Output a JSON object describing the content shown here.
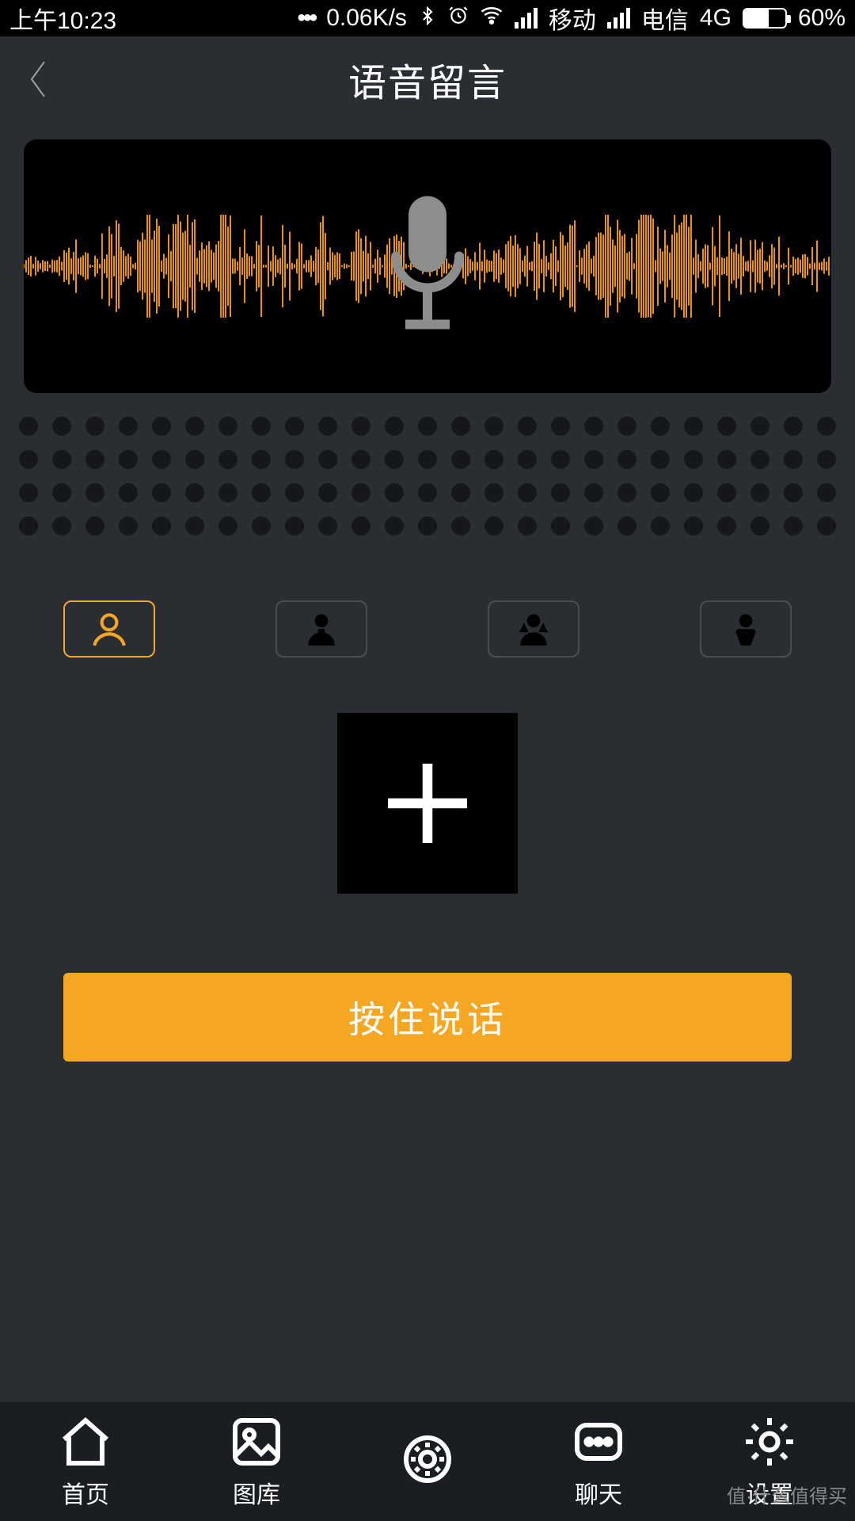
{
  "status": {
    "time": "上午10:23",
    "speed": "0.06K/s",
    "carrier1": "移动",
    "carrier2": "电信",
    "net": "4G",
    "battery_pct": "60%"
  },
  "header": {
    "title": "语音留言"
  },
  "voice_types": {
    "items": [
      {
        "name": "original",
        "selected": true
      },
      {
        "name": "man",
        "selected": false
      },
      {
        "name": "woman",
        "selected": false
      },
      {
        "name": "baby",
        "selected": false
      }
    ]
  },
  "actions": {
    "add_label": "+",
    "talk_label": "按住说话"
  },
  "nav": {
    "items": [
      {
        "key": "home",
        "label": "首页"
      },
      {
        "key": "gallery",
        "label": "图库"
      },
      {
        "key": "brightness",
        "label": ""
      },
      {
        "key": "chat",
        "label": "聊天"
      },
      {
        "key": "settings",
        "label": "设置"
      }
    ]
  },
  "watermark": "值·什么值得买"
}
